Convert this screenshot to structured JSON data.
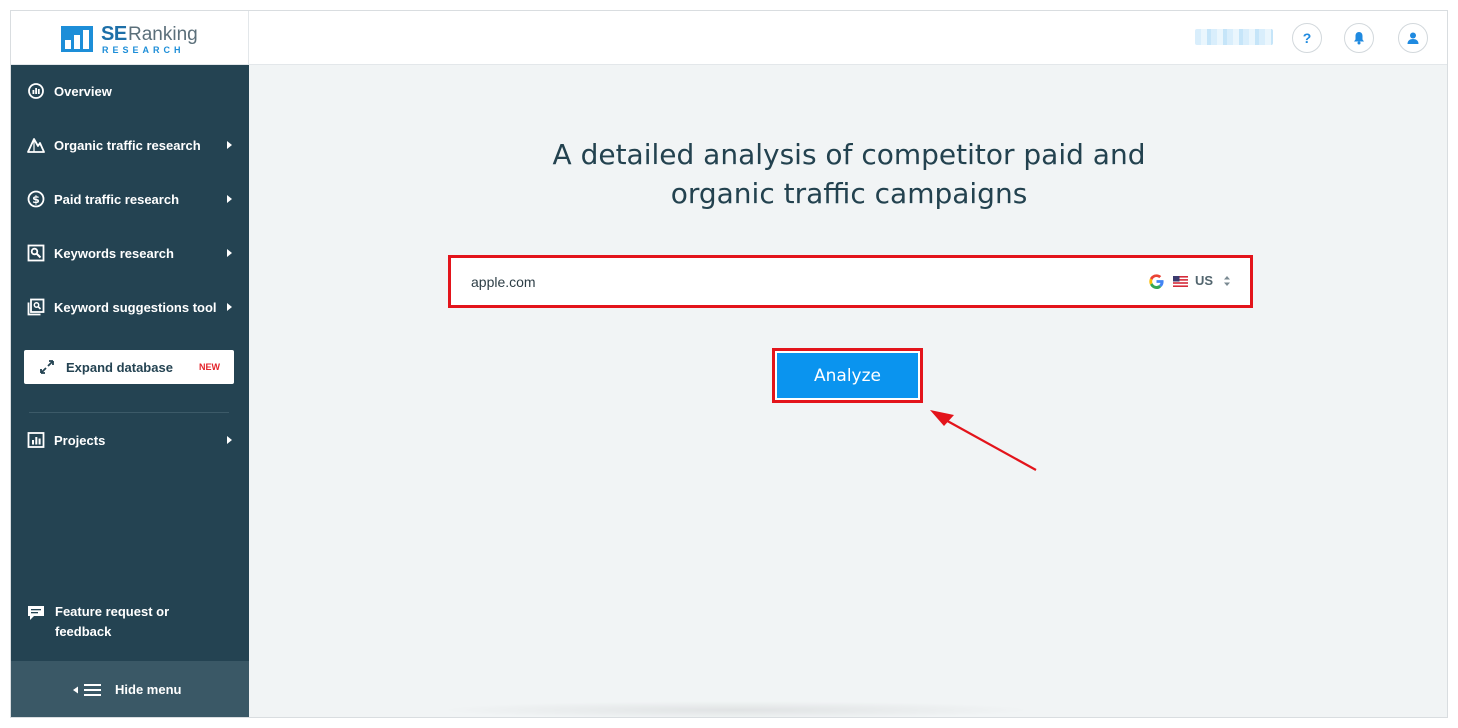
{
  "brand": {
    "logo_se": "SE",
    "logo_ranking": "Ranking",
    "logo_research": "RESEARCH"
  },
  "header": {
    "help_icon": "question-icon",
    "notifications_icon": "bell-icon",
    "profile_icon": "user-icon"
  },
  "sidebar": {
    "items": [
      {
        "label": "Overview",
        "icon": "overview-gauge-icon",
        "has_submenu": false
      },
      {
        "label": "Organic traffic research",
        "icon": "organic-mountain-icon",
        "has_submenu": true
      },
      {
        "label": "Paid traffic research",
        "icon": "dollar-icon",
        "has_submenu": true
      },
      {
        "label": "Keywords research",
        "icon": "key-search-icon",
        "has_submenu": true
      },
      {
        "label": "Keyword suggestions tool",
        "icon": "suggestions-icon",
        "has_submenu": true
      }
    ],
    "expand": {
      "label": "Expand database",
      "badge": "NEW",
      "icon": "expand-arrows-icon"
    },
    "projects": {
      "label": "Projects",
      "icon": "bar-chart-icon",
      "has_submenu": true
    },
    "feedback": {
      "label": "Feature request or feedback",
      "icon": "chat-bubble-icon"
    },
    "hide_menu": {
      "label": "Hide menu",
      "icon": "hamburger-collapse-icon"
    }
  },
  "main": {
    "headline_line1": "A detailed analysis of competitor paid and",
    "headline_line2": "organic traffic campaigns",
    "search": {
      "value": "apple.com",
      "search_engine_icon": "google-icon",
      "flag_icon": "us-flag-icon",
      "country": "US"
    },
    "analyze_label": "Analyze"
  },
  "colors": {
    "sidebar_bg": "#244352",
    "accent": "#0a94ef",
    "highlight": "#e3141b",
    "badge": "#e4242b"
  }
}
